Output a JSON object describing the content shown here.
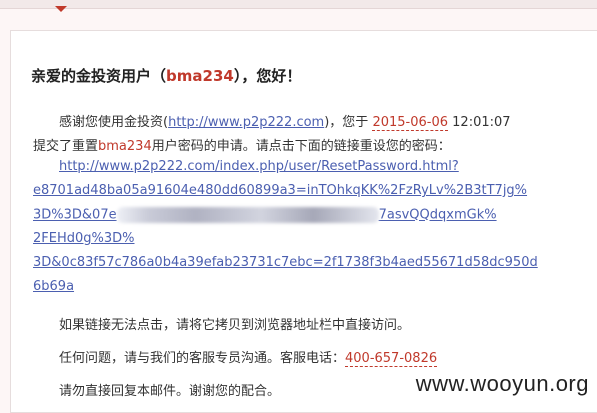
{
  "greeting": {
    "prefix": "亲爱的金投资用户（",
    "username": "bma234",
    "suffix": "），您好！"
  },
  "body": {
    "line1_prefix": "感谢您使用金投资(",
    "site_link": "http://www.p2p222.com",
    "line1_mid": ")，您于",
    "date": "2015-06-06",
    "time": "12:01:07",
    "line2_prefix": "提交了重置",
    "username": "bma234",
    "line2_suffix": "用户密码的申请。请点击下面的链接重设您的密码：",
    "reset_link": {
      "line1": "http://www.p2p222.com/index.php/user/ResetPassword.html?",
      "line2": "e8701ad48ba05a91604e480dd60899a3=inTOhkqKK%2FzRyLv%2B3tT7jg%",
      "line3_start": "3D%3D&07e",
      "line3_end": "7asvQQdqxmGk%",
      "line4": "2FEHd0g%3D%",
      "line5": "3D&0c83f57c786a0b4a39efab23731c7ebc=2f1738f3b4aed55671d58dc950d",
      "line6": "6b69a"
    },
    "copy_hint": "如果链接无法点击，请将它拷贝到浏览器地址栏中直接访问。",
    "contact_prefix": "任何问题，请与我们的客服专员沟通。客服电话：",
    "phone": "400-657-0826",
    "no_reply": "请勿直接回复本邮件。谢谢您的配合。"
  },
  "watermark": "www.wooyun.org"
}
